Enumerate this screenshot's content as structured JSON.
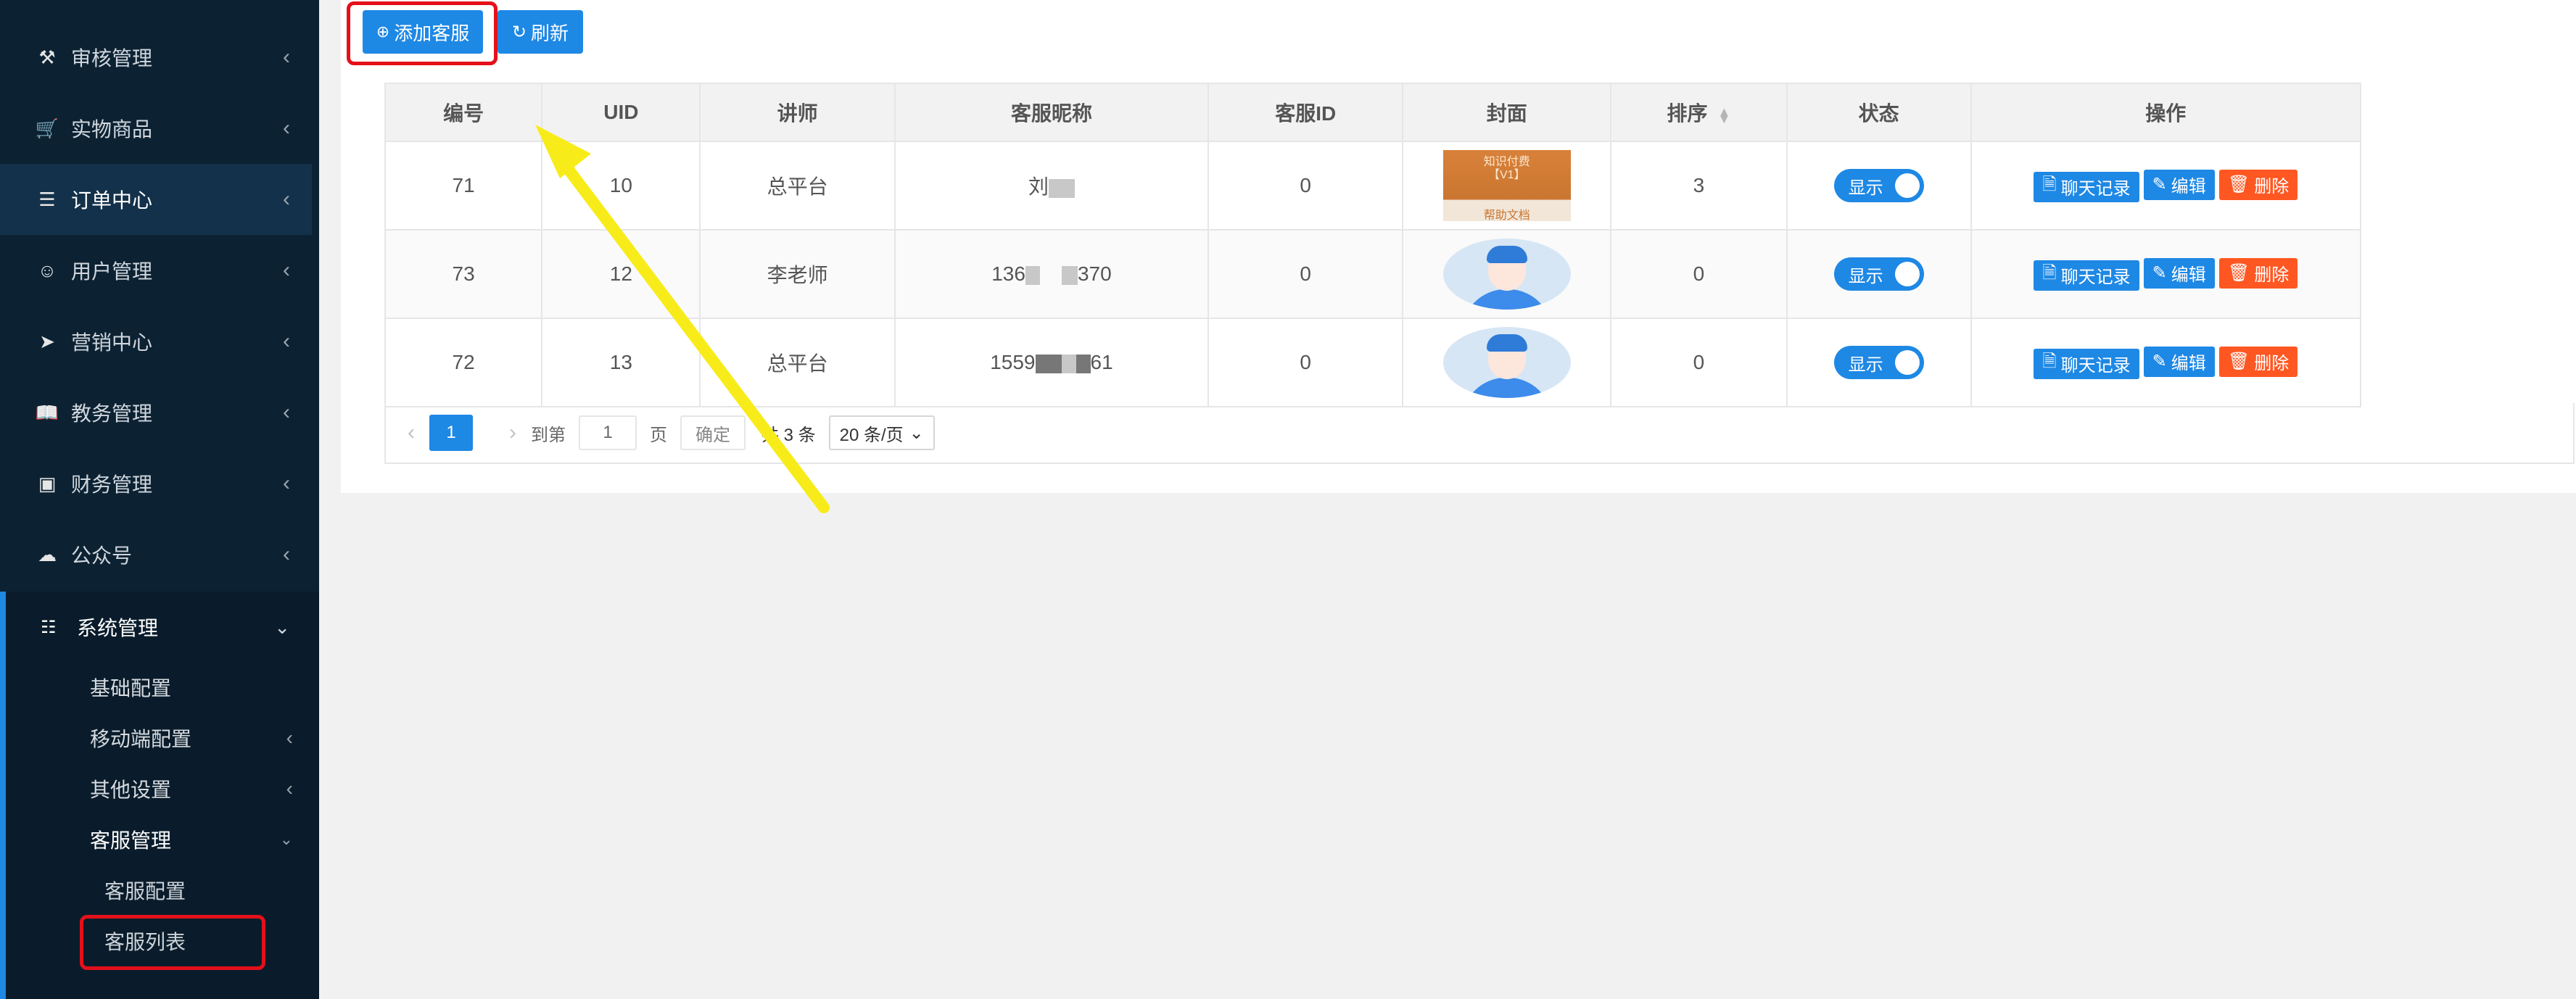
{
  "sidebar": {
    "items": [
      {
        "label": "审核管理",
        "icon": "gavel-icon"
      },
      {
        "label": "实物商品",
        "icon": "cart-icon"
      },
      {
        "label": "订单中心",
        "icon": "list-icon"
      },
      {
        "label": "用户管理",
        "icon": "user-icon"
      },
      {
        "label": "营销中心",
        "icon": "send-icon"
      },
      {
        "label": "教务管理",
        "icon": "book-icon"
      },
      {
        "label": "财务管理",
        "icon": "money-icon"
      },
      {
        "label": "公众号",
        "icon": "wechat-icon"
      }
    ],
    "system": {
      "label": "系统管理",
      "icon": "grid-icon"
    },
    "sub_items": [
      "基础配置",
      "移动端配置",
      "其他设置",
      "客服管理"
    ],
    "sub2_items": [
      "客服配置",
      "客服列表"
    ]
  },
  "toolbar": {
    "add_label": "添加客服",
    "refresh_label": "刷新"
  },
  "table": {
    "headers": [
      "编号",
      "UID",
      "讲师",
      "客服昵称",
      "客服ID",
      "封面",
      "排序",
      "状态",
      "操作"
    ],
    "rows": [
      {
        "id": "71",
        "uid": "10",
        "teacher": "总平台",
        "nick_a": "刘",
        "nick_b": "",
        "kefu_id": "0",
        "sort": "3",
        "status": "显示",
        "cover": "book"
      },
      {
        "id": "73",
        "uid": "12",
        "teacher": "李老师",
        "nick_a": "136",
        "nick_b": "370",
        "kefu_id": "0",
        "sort": "0",
        "status": "显示",
        "cover": "avatar"
      },
      {
        "id": "72",
        "uid": "13",
        "teacher": "总平台",
        "nick_a": "1559",
        "nick_b": "61",
        "kefu_id": "0",
        "sort": "0",
        "status": "显示",
        "cover": "avatar"
      }
    ],
    "actions": {
      "chat": "聊天记录",
      "edit": "编辑",
      "delete": "删除"
    },
    "cover_text": {
      "line1": "知识付费",
      "line2": "【V1】",
      "line3": "帮助文档"
    }
  },
  "pager": {
    "current": "1",
    "goto_label": "到第",
    "page_input": "1",
    "page_unit": "页",
    "confirm": "确定",
    "total": "共 3 条",
    "page_size": "20 条/页"
  },
  "colors": {
    "primary": "#1e88e5",
    "danger": "#ff5722",
    "sidebar": "#0c2233",
    "highlight": "#e4101a",
    "arrow": "#f7ec1a"
  }
}
